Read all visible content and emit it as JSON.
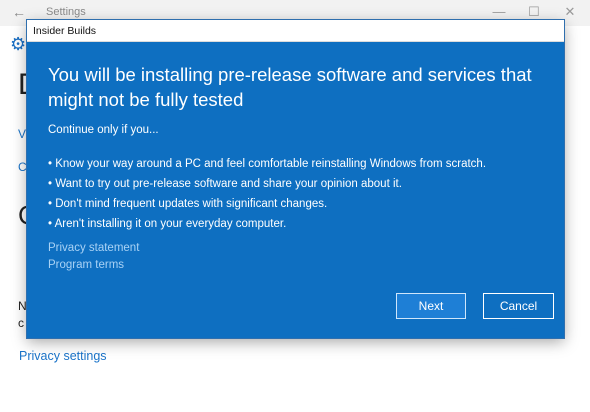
{
  "settings_window": {
    "title": "Settings",
    "back_glyph": "←",
    "minimize_glyph": "—",
    "maximize_glyph": "☐",
    "close_glyph": "✕",
    "gear_icon": "gear-icon",
    "partial_heading": "D",
    "partial_link_v": "V",
    "partial_link_c": "C",
    "partial_heading_c": "C",
    "partial_text_n": "N",
    "partial_text_c": "c",
    "privacy_settings_link": "Privacy settings"
  },
  "dialog": {
    "title": "Insider Builds",
    "heading": "You will be installing pre-release software and services that might not be fully tested",
    "subheading": "Continue only if you...",
    "bullets": [
      "• Know your way around a PC and feel comfortable reinstalling Windows from scratch.",
      "• Want to try out pre-release software and share your opinion about it.",
      "• Don't mind frequent updates with significant changes.",
      "• Aren't installing it on your everyday computer."
    ],
    "privacy_statement": "Privacy statement",
    "program_terms": "Program terms",
    "next_label": "Next",
    "cancel_label": "Cancel"
  },
  "colors": {
    "dialog_background": "#0e6fc1",
    "link_on_blue": "#a9d2f5",
    "link_on_white": "#1a73c8"
  }
}
